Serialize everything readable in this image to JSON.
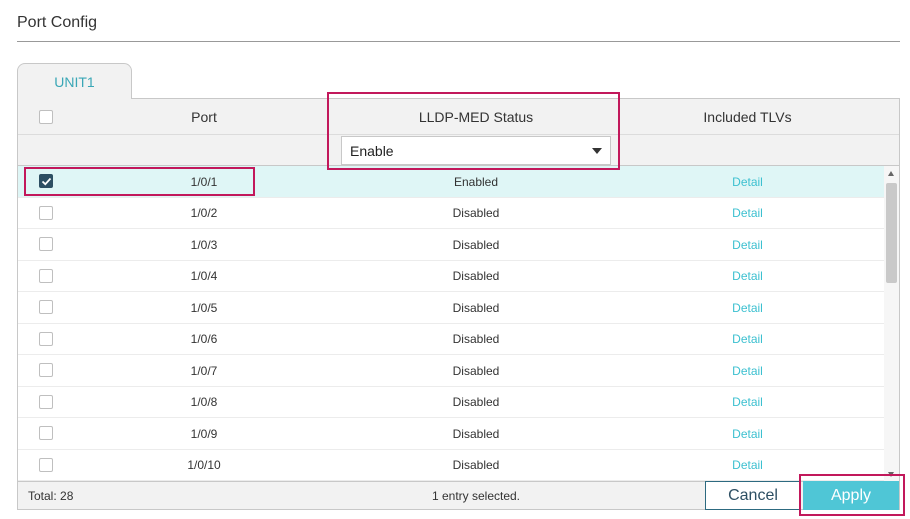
{
  "page": {
    "title": "Port Config"
  },
  "tabs": [
    {
      "label": "UNIT1",
      "active": true
    }
  ],
  "table": {
    "headers": {
      "port": "Port",
      "lldp_med_status": "LLDP-MED Status",
      "included_tlvs": "Included TLVs"
    },
    "filter": {
      "lldp_med_status_value": "Enable"
    },
    "rows": [
      {
        "port": "1/0/1",
        "status": "Enabled",
        "tlvs": "Detail",
        "checked": true
      },
      {
        "port": "1/0/2",
        "status": "Disabled",
        "tlvs": "Detail",
        "checked": false
      },
      {
        "port": "1/0/3",
        "status": "Disabled",
        "tlvs": "Detail",
        "checked": false
      },
      {
        "port": "1/0/4",
        "status": "Disabled",
        "tlvs": "Detail",
        "checked": false
      },
      {
        "port": "1/0/5",
        "status": "Disabled",
        "tlvs": "Detail",
        "checked": false
      },
      {
        "port": "1/0/6",
        "status": "Disabled",
        "tlvs": "Detail",
        "checked": false
      },
      {
        "port": "1/0/7",
        "status": "Disabled",
        "tlvs": "Detail",
        "checked": false
      },
      {
        "port": "1/0/8",
        "status": "Disabled",
        "tlvs": "Detail",
        "checked": false
      },
      {
        "port": "1/0/9",
        "status": "Disabled",
        "tlvs": "Detail",
        "checked": false
      },
      {
        "port": "1/0/10",
        "status": "Disabled",
        "tlvs": "Detail",
        "checked": false
      }
    ],
    "footer": {
      "total": "Total: 28",
      "selected": "1 entry selected."
    }
  },
  "buttons": {
    "cancel": "Cancel",
    "apply": "Apply"
  },
  "colors": {
    "accent": "#4fc6d6",
    "link": "#3cc0d0",
    "highlight": "#c2185b",
    "selected_row": "#dff6f6"
  },
  "icons": {
    "checkbox_checked": "check-icon",
    "dropdown": "chevron-down-icon"
  }
}
